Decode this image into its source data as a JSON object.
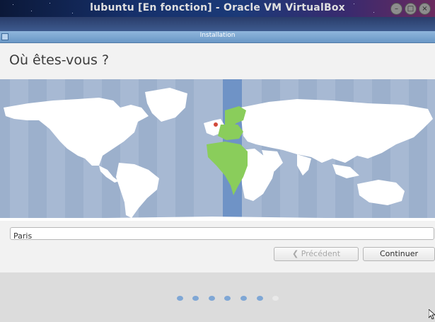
{
  "host_window": {
    "title": "lubuntu [En fonction] - Oracle VM VirtualBox",
    "controls": [
      "minimize-icon",
      "maximize-icon",
      "close-icon"
    ]
  },
  "installer": {
    "window_title": "Installation",
    "heading": "Où êtes-vous ?",
    "location_field_value": "Paris",
    "buttons": {
      "previous": "Précédent",
      "continue": "Continuer"
    },
    "progress": {
      "total_steps": 7,
      "completed_steps": 6
    }
  },
  "map": {
    "selected_timezone_region": "Europe/Paris",
    "highlight_color": "#8acd5b",
    "marker_color": "#d24a3a",
    "ocean_color": "#a7b9d3",
    "land_color": "#ffffff"
  }
}
